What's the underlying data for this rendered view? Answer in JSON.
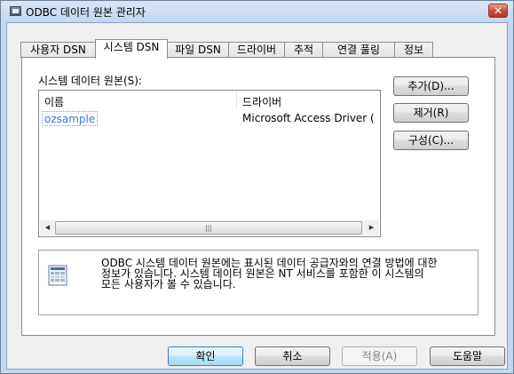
{
  "window": {
    "title": "ODBC 데이터 원본 관리자",
    "close_label": "✕"
  },
  "tabs": [
    {
      "label": "사용자 DSN",
      "active": false
    },
    {
      "label": "시스템 DSN",
      "active": true
    },
    {
      "label": "파일 DSN",
      "active": false
    },
    {
      "label": "드라이버",
      "active": false
    },
    {
      "label": "추적",
      "active": false
    },
    {
      "label": "연결 풀링",
      "active": false
    },
    {
      "label": "정보",
      "active": false
    }
  ],
  "panel": {
    "section_label": "시스템 데이터 원본(S):",
    "list": {
      "columns": [
        "이름",
        "드라이버"
      ],
      "rows": [
        {
          "name": "ozsample",
          "driver": "Microsoft Access Driver (",
          "selected": true
        }
      ],
      "scroll_left": "◀",
      "scroll_right": "▶",
      "scroll_thumb": "|||"
    },
    "buttons": {
      "add": "추가(D)...",
      "remove": "제거(R)",
      "configure": "구성(C)..."
    },
    "info_text": "ODBC 시스템 데이터 원본에는 표시된 데이터 공급자와의 연결 방법에 대한\n정보가 있습니다. 시스템 데이터 원본은 NT 서비스를 포함한 이 시스템의\n모든 사용자가 볼 수 있습니다.",
    "info_icon": "database-document-icon"
  },
  "footer": {
    "ok": "확인",
    "cancel": "취소",
    "apply": "적용(A)",
    "help": "도움말"
  }
}
